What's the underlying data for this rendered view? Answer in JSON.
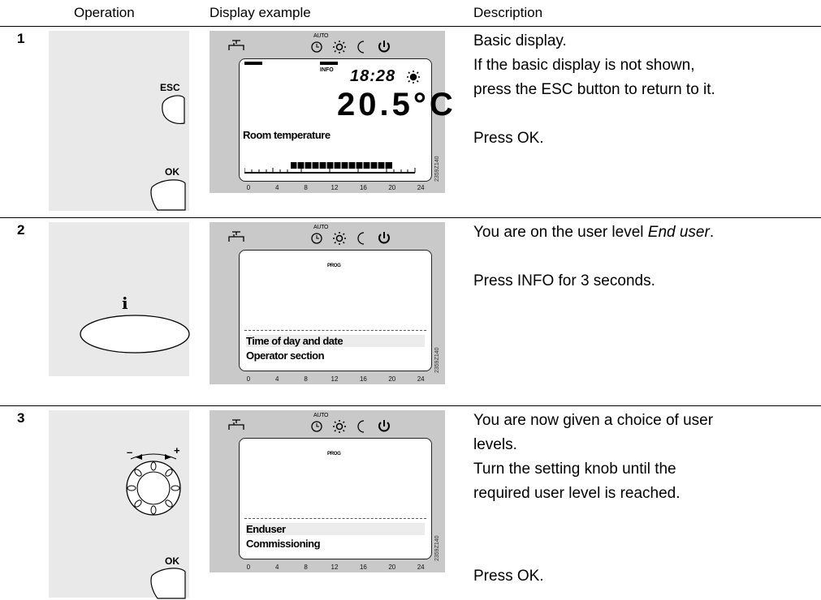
{
  "headers": {
    "operation": "Operation",
    "display": "Display example",
    "description": "Description"
  },
  "lcd_ticks": [
    "0",
    "4",
    "8",
    "12",
    "16",
    "20",
    "24"
  ],
  "doc_code": "2359Z140",
  "icons": [
    "tap-icon",
    "auto-clock-icon",
    "sun-icon",
    "moon-icon",
    "power-icon"
  ],
  "auto_label": "AUTO",
  "steps": [
    {
      "num": "1",
      "buttons": {
        "esc": "ESC",
        "ok": "OK"
      },
      "display": {
        "info": "INFO",
        "time": "18:28",
        "temp": "20.5°C",
        "label": "Room temperature"
      },
      "desc_lines": [
        "Basic display.",
        "If the basic display is not shown,",
        "press the ESC button to return to it.",
        "",
        "Press OK."
      ]
    },
    {
      "num": "2",
      "buttons": {
        "info_symbol": "i"
      },
      "display": {
        "prog": "PROG",
        "line1": "Time of day and date",
        "line2": "Operator section"
      },
      "desc_a": "You are on the user level ",
      "desc_em": "End user",
      "desc_b": ".",
      "desc_lines": [
        "",
        "Press INFO for 3 seconds."
      ]
    },
    {
      "num": "3",
      "buttons": {
        "minus": "–",
        "plus": "+",
        "ok": "OK"
      },
      "display": {
        "prog": "PROG",
        "line1": "Enduser",
        "line2": "Commissioning"
      },
      "desc_lines": [
        "You are now given a choice of user",
        "levels.",
        "Turn the setting knob until the",
        "required user level is reached."
      ],
      "desc_last": "Press OK."
    }
  ]
}
